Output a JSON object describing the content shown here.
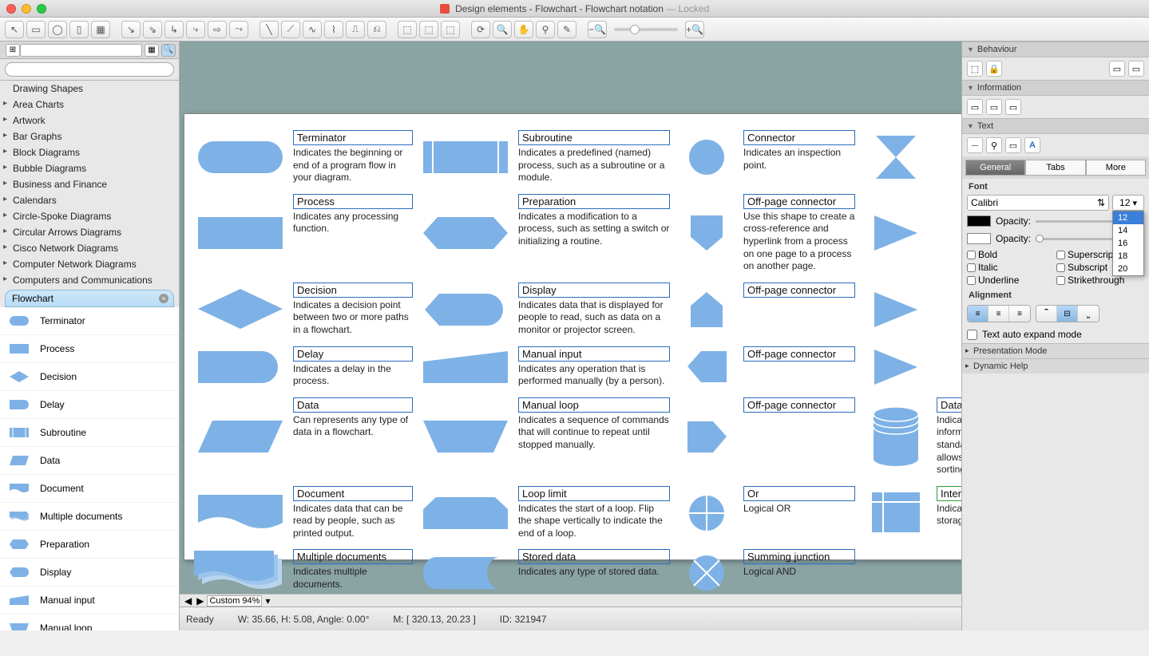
{
  "window": {
    "title": "Design elements - Flowchart - Flowchart notation",
    "locked": "— Locked"
  },
  "sidebar": {
    "heading": "Drawing Shapes",
    "categories": [
      "Area Charts",
      "Artwork",
      "Bar Graphs",
      "Block Diagrams",
      "Bubble Diagrams",
      "Business and Finance",
      "Calendars",
      "Circle-Spoke Diagrams",
      "Circular Arrows Diagrams",
      "Cisco Network Diagrams",
      "Computer Network Diagrams",
      "Computers and Communications"
    ],
    "active_tab": "Flowchart",
    "shapes": [
      "Terminator",
      "Process",
      "Decision",
      "Delay",
      "Subroutine",
      "Data",
      "Document",
      "Multiple documents",
      "Preparation",
      "Display",
      "Manual input",
      "Manual loop"
    ]
  },
  "canvas": {
    "col1": [
      {
        "t": "Terminator",
        "d": "Indicates the beginning or end of a program flow in your diagram."
      },
      {
        "t": "Process",
        "d": "Indicates any processing function."
      },
      {
        "t": "Decision",
        "d": "Indicates a decision point between two or more paths in a flowchart."
      },
      {
        "t": "Delay",
        "d": "Indicates a delay in the process."
      },
      {
        "t": "Data",
        "d": "Can represents any type of data in a flowchart."
      },
      {
        "t": "Document",
        "d": "Indicates data that can be read by people, such as printed output."
      },
      {
        "t": "Multiple documents",
        "d": "Indicates multiple documents."
      }
    ],
    "col2": [
      {
        "t": "Subroutine",
        "d": "Indicates a predefined (named) process, such as a subroutine or a module."
      },
      {
        "t": "Preparation",
        "d": "Indicates a modification to a process, such as setting a switch or initializing a routine."
      },
      {
        "t": "Display",
        "d": "Indicates data that is displayed for people to read, such as data on a monitor or projector screen."
      },
      {
        "t": "Manual input",
        "d": "Indicates any operation that is performed manually (by a person)."
      },
      {
        "t": "Manual loop",
        "d": "Indicates a sequence of commands that will continue to repeat until stopped manually."
      },
      {
        "t": "Loop limit",
        "d": "Indicates the start of a loop. Flip the shape vertically to indicate the end of a loop."
      },
      {
        "t": "Stored data",
        "d": "Indicates any type of stored data."
      }
    ],
    "col3": [
      {
        "t": "Connector",
        "d": "Indicates an inspection point."
      },
      {
        "t": "Off-page connector",
        "d": "Use this shape to create a cross-reference and hyperlink from a process on one page to a process on another page."
      },
      {
        "t": "Off-page connector",
        "d": ""
      },
      {
        "t": "Off-page connector",
        "d": ""
      },
      {
        "t": "Off-page connector",
        "d": ""
      },
      {
        "t": "Or",
        "d": "Logical OR"
      },
      {
        "t": "Summing junction",
        "d": "Logical AND"
      }
    ],
    "col4": [
      {
        "t": "Database",
        "d": "Indicates a list of information with a standard structure that allows for searching and sorting."
      },
      {
        "t": "Internal storage",
        "d": "Indicates an internal storage device.",
        "green": true
      }
    ]
  },
  "status": {
    "ready": "Ready",
    "dims": "W: 35.66,  H: 5.08,  Angle: 0.00°",
    "mouse": "M: [ 320.13, 20.23 ]",
    "id": "ID: 321947",
    "zoom": "Custom 94%"
  },
  "inspector": {
    "sections": [
      "Behaviour",
      "Information",
      "Text"
    ],
    "tabs": [
      "General",
      "Tabs",
      "More"
    ],
    "font_label": "Font",
    "font_name": "Calibri",
    "font_size": "12",
    "size_options": [
      "12",
      "14",
      "16",
      "18",
      "20"
    ],
    "opacity_label": "Opacity:",
    "style_checks": [
      "Bold",
      "Superscript",
      "Italic",
      "Subscript",
      "Underline",
      "Strikethrough"
    ],
    "alignment_label": "Alignment",
    "auto_expand": "Text auto expand mode",
    "footer": [
      "Presentation Mode",
      "Dynamic Help"
    ]
  }
}
